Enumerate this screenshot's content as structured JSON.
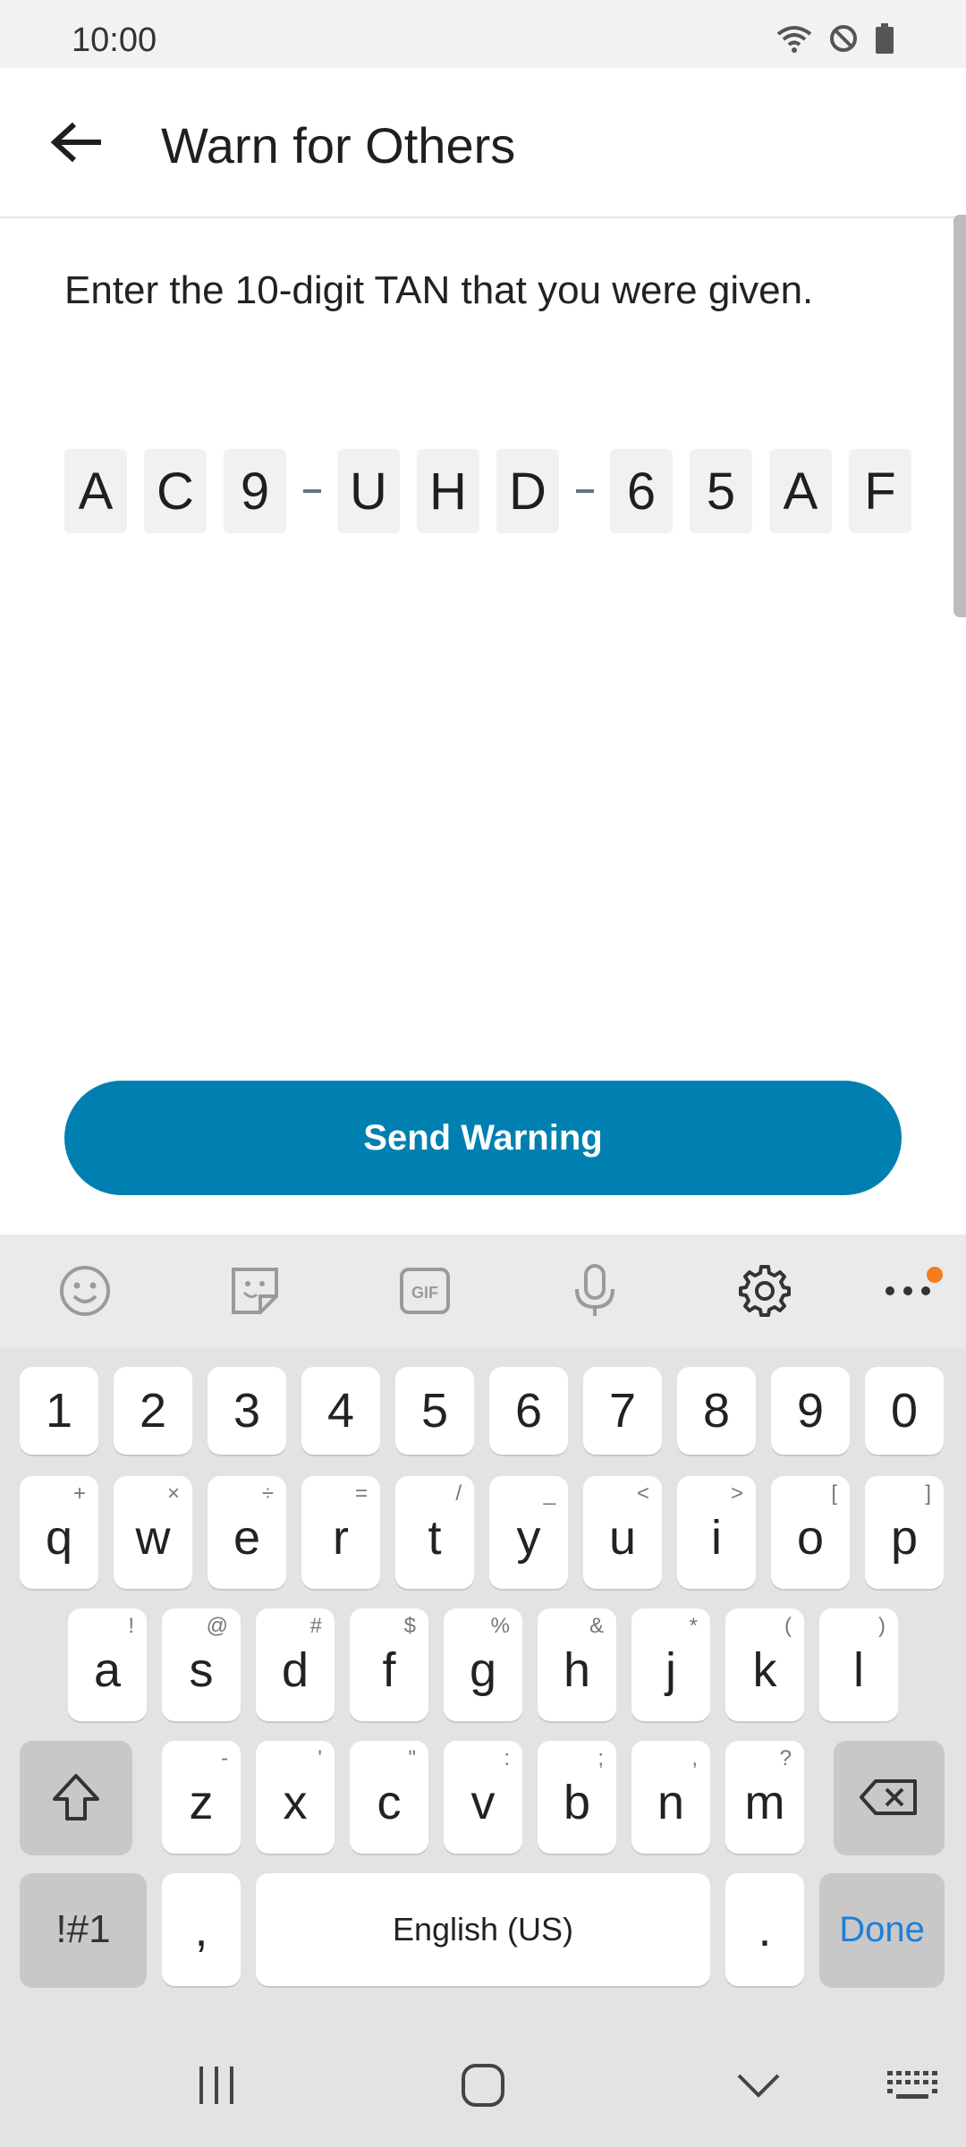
{
  "status": {
    "time": "10:00"
  },
  "app_bar": {
    "title": "Warn for Others"
  },
  "content": {
    "prompt": "Enter the 10-digit TAN that you were given.",
    "tan_chars": [
      "A",
      "C",
      "9",
      "U",
      "H",
      "D",
      "6",
      "5",
      "A",
      "F"
    ],
    "send_button": "Send Warning"
  },
  "keyboard": {
    "toolbar_icons": [
      "emoji-icon",
      "sticker-icon",
      "gif-icon",
      "microphone-icon",
      "settings-icon",
      "more-icon"
    ],
    "numbers": [
      "1",
      "2",
      "3",
      "4",
      "5",
      "6",
      "7",
      "8",
      "9",
      "0"
    ],
    "row1": [
      {
        "k": "q",
        "s": "+"
      },
      {
        "k": "w",
        "s": "×"
      },
      {
        "k": "e",
        "s": "÷"
      },
      {
        "k": "r",
        "s": "="
      },
      {
        "k": "t",
        "s": "/"
      },
      {
        "k": "y",
        "s": "_"
      },
      {
        "k": "u",
        "s": "<"
      },
      {
        "k": "i",
        "s": ">"
      },
      {
        "k": "o",
        "s": "["
      },
      {
        "k": "p",
        "s": "]"
      }
    ],
    "row2": [
      {
        "k": "a",
        "s": "!"
      },
      {
        "k": "s",
        "s": "@"
      },
      {
        "k": "d",
        "s": "#"
      },
      {
        "k": "f",
        "s": "$"
      },
      {
        "k": "g",
        "s": "%"
      },
      {
        "k": "h",
        "s": "&"
      },
      {
        "k": "j",
        "s": "*"
      },
      {
        "k": "k",
        "s": "("
      },
      {
        "k": "l",
        "s": ")"
      }
    ],
    "row3": [
      {
        "k": "z",
        "s": "-"
      },
      {
        "k": "x",
        "s": "'"
      },
      {
        "k": "c",
        "s": "\""
      },
      {
        "k": "v",
        "s": ":"
      },
      {
        "k": "b",
        "s": ";"
      },
      {
        "k": "n",
        "s": ","
      },
      {
        "k": "m",
        "s": "?"
      }
    ],
    "symbols_key": "!#1",
    "comma_key": ",",
    "space_label": "English (US)",
    "period_key": ".",
    "done_key": "Done"
  }
}
